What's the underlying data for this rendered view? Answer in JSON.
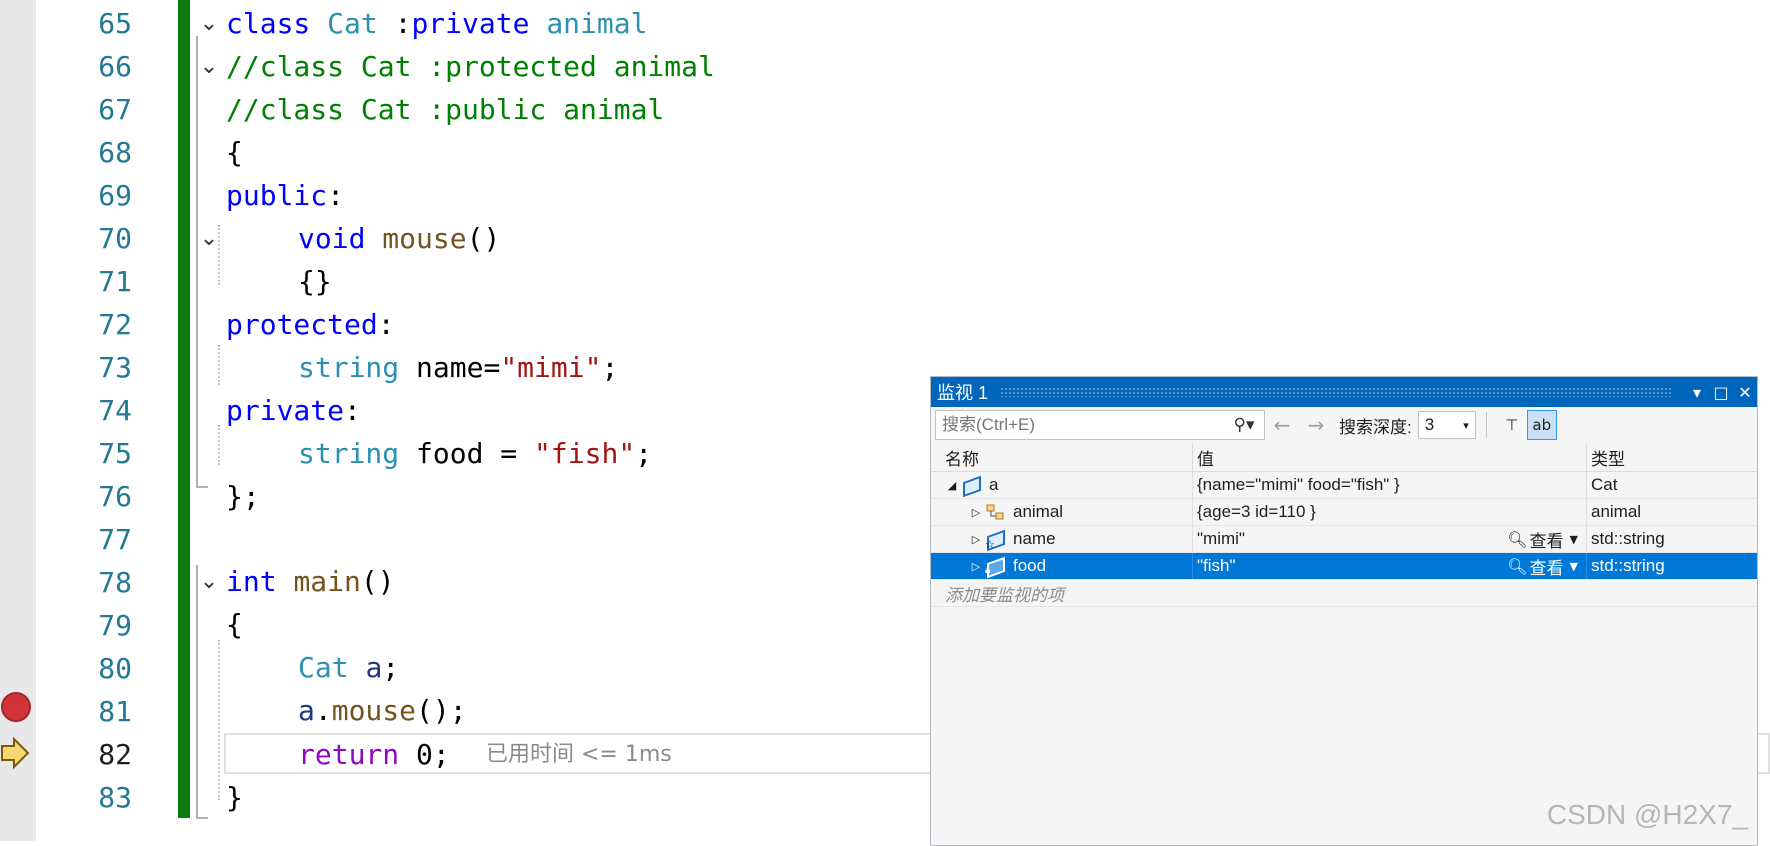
{
  "editor": {
    "line_numbers": [
      "65",
      "66",
      "67",
      "68",
      "69",
      "70",
      "71",
      "72",
      "73",
      "74",
      "75",
      "76",
      "77",
      "78",
      "79",
      "80",
      "81",
      "82",
      "83"
    ],
    "lines": {
      "l65": {
        "kw": "class",
        "ty": "Cat",
        "op": " :",
        "kw2": "private",
        "ty2": "animal"
      },
      "l66": "//class Cat :protected animal",
      "l67": "//class Cat :public animal",
      "l68": "{",
      "l69": {
        "kw": "public",
        "p": ":"
      },
      "l70": {
        "kw": "void",
        "fn": "mouse",
        "p": "()"
      },
      "l71": "{}",
      "l72": {
        "kw": "protected",
        "p": ":"
      },
      "l73": {
        "ty": "string",
        "txt": "name=",
        "str": "\"mimi\"",
        "p": ";"
      },
      "l74": {
        "kw": "private",
        "p": ":"
      },
      "l75": {
        "ty": "string",
        "txt": "food = ",
        "str": "\"fish\"",
        "p": ";"
      },
      "l76": "};",
      "l78": {
        "kw": "int",
        "fn": "main",
        "p": "()"
      },
      "l79": "{",
      "l80": {
        "ty": "Cat",
        "var": "a",
        "p": ";"
      },
      "l81": {
        "var": "a",
        "p1": ".",
        "fn": "mouse",
        "p2": "();"
      },
      "l82": {
        "ctl": "return",
        "num": "0",
        "p": ";"
      },
      "l83": "}"
    },
    "elapsed_hint": "已用时间 <= 1ms"
  },
  "watch": {
    "title": "监视 1",
    "search_placeholder": "搜索(Ctrl+E)",
    "depth_label": "搜索深度:",
    "depth_value": "3",
    "columns": {
      "name": "名称",
      "value": "值",
      "type": "类型"
    },
    "rows": [
      {
        "name": "a",
        "value": "{name=\"mimi\" food=\"fish\" }",
        "type": "Cat"
      },
      {
        "name": "animal",
        "value": "{age=3 id=110 }",
        "type": "animal"
      },
      {
        "name": "name",
        "value": "\"mimi\"",
        "type": "std::string",
        "viewer": "查看"
      },
      {
        "name": "food",
        "value": "\"fish\"",
        "type": "std::string",
        "viewer": "查看"
      }
    ],
    "add_watch_hint": "添加要监视的项"
  },
  "watermark": "CSDN @H2X7_"
}
